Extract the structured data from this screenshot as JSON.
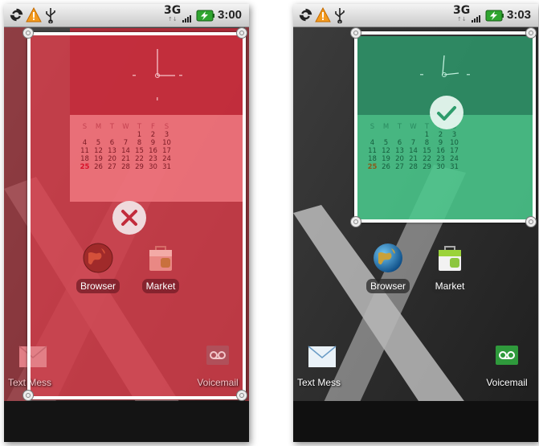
{
  "status_left": {
    "network": "3G",
    "network_sub": "↑↓",
    "time": "3:00"
  },
  "status_right": {
    "network": "3G",
    "network_sub": "↑↓",
    "time": "3:03"
  },
  "calendar": {
    "weekdays": [
      "S",
      "M",
      "T",
      "W",
      "T",
      "F",
      "S"
    ],
    "weeks": [
      [
        "",
        "",
        "",
        "",
        "1",
        "2",
        "3"
      ],
      [
        "4",
        "5",
        "6",
        "7",
        "8",
        "9",
        "10"
      ],
      [
        "11",
        "12",
        "13",
        "14",
        "15",
        "16",
        "17"
      ],
      [
        "18",
        "19",
        "20",
        "21",
        "22",
        "23",
        "24"
      ],
      [
        "25",
        "26",
        "27",
        "28",
        "29",
        "30",
        "31"
      ]
    ],
    "today": "25"
  },
  "apps": {
    "browser": "Browser",
    "market": "Market",
    "text_messaging": "Text Mess",
    "voicemail": "Voicemail"
  },
  "colors": {
    "reject_overlay": "#e23a4a",
    "accept_overlay": "#3fcf8e",
    "frame": "#ffffff"
  },
  "left_state": "reject-x",
  "right_state": "accept-check"
}
